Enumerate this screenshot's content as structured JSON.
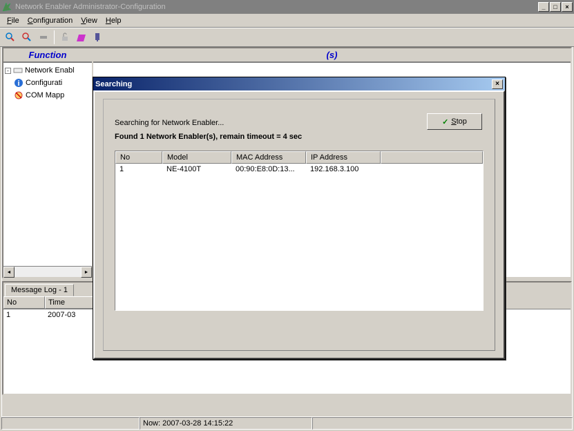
{
  "window": {
    "title": "Network Enabler Administrator-Configuration",
    "min_label": "_",
    "max_label": "□",
    "close_label": "×"
  },
  "menu": {
    "file": "File",
    "configuration": "Configuration",
    "view": "View",
    "help": "Help"
  },
  "panes": {
    "left_header": "Function",
    "right_header": "(s)"
  },
  "tree": {
    "root": "Network Enabl",
    "child1": "Configurati",
    "child2": "COM Mapp",
    "expand_glyph": "-"
  },
  "log": {
    "tab_label": "Message Log - 1",
    "columns": {
      "no": "No",
      "time": "Time"
    },
    "rows": [
      {
        "no": "1",
        "time": "2007-03"
      }
    ]
  },
  "status": {
    "now": "Now: 2007-03-28 14:15:22"
  },
  "dialog": {
    "title": "Searching",
    "close_glyph": "×",
    "line1": "Searching for Network Enabler...",
    "line2": "Found 1 Network Enabler(s), remain timeout = 4 sec",
    "stop_label": "Stop",
    "columns": {
      "no": "No",
      "model": "Model",
      "mac": "MAC Address",
      "ip": "IP Address"
    },
    "rows": [
      {
        "no": "1",
        "model": "NE-4100T",
        "mac": "00:90:E8:0D:13...",
        "ip": "192.168.3.100"
      }
    ]
  }
}
